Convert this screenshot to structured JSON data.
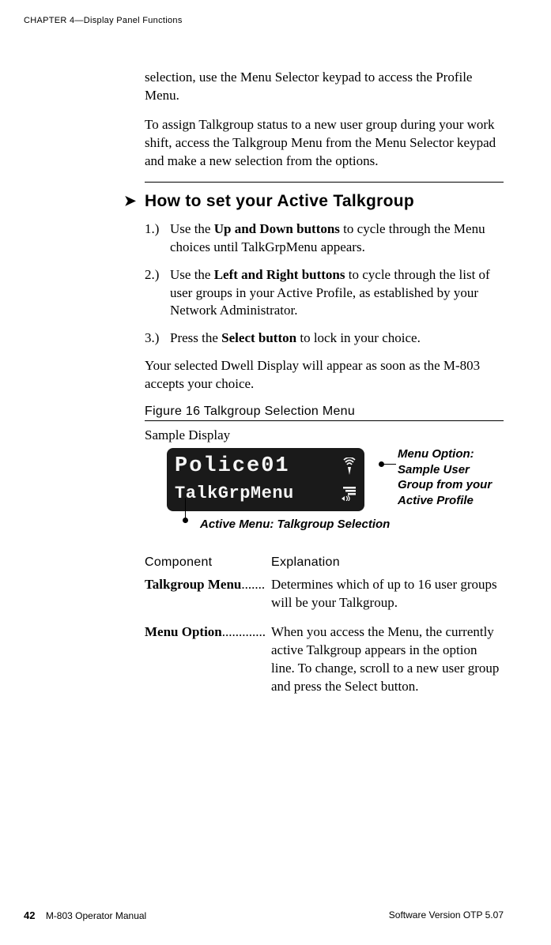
{
  "header": {
    "running": "CHAPTER 4—Display Panel Functions"
  },
  "intro": {
    "p1": "selection, use the Menu Selector keypad to access the Profile Menu.",
    "p2": "To assign Talkgroup status to a new user group during your work shift, access the Talkgroup Menu from the Menu Selector keypad and make a new selection from the options."
  },
  "section": {
    "title": "How to set your Active Talkgroup",
    "steps": [
      {
        "num": "1.)",
        "pre": "Use the ",
        "bold": "Up and Down buttons",
        "post": " to cycle through the Menu choices until TalkGrpMenu appears."
      },
      {
        "num": "2.)",
        "pre": "Use the ",
        "bold": "Left and Right buttons",
        "post": " to cycle through the list of user groups in your Active Profile, as established by your Network Administrator."
      },
      {
        "num": "3.)",
        "pre": "Press the ",
        "bold": "Select button",
        "post": " to lock in your choice."
      }
    ],
    "note": "Your selected Dwell Display will appear as soon as the M-803 accepts your choice."
  },
  "figure": {
    "caption": "Figure 16 Talkgroup Selection Menu",
    "sample_label": "Sample Display",
    "lcd": {
      "line1": "Police01",
      "line2": "TalkGrpMenu"
    },
    "callout_right_l1": "Menu Option:",
    "callout_right_l2": "Sample User",
    "callout_right_l3": "Group from your",
    "callout_right_l4": "Active Profile",
    "callout_bottom": "Active Menu: Talkgroup Selection"
  },
  "table": {
    "h1": "Component",
    "h2": "Explanation",
    "rows": [
      {
        "name": "Talkgroup Menu",
        "dots": ".......",
        "text": "Determines which of up to 16 user groups will be your Talkgroup."
      },
      {
        "name": "Menu Option",
        "dots": ".............",
        "text": "When you access the Menu, the currently active Talkgroup appears in the option line. To change, scroll to a new user group and press the Select button."
      }
    ]
  },
  "footer": {
    "page": "42",
    "manual": "M-803 Operator Manual",
    "version": "Software Version OTP 5.07"
  }
}
